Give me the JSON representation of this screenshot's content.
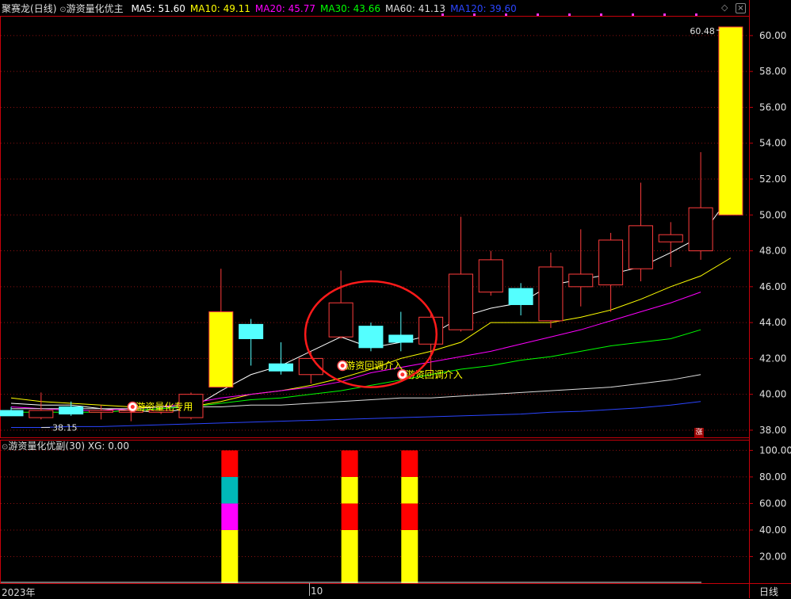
{
  "header": {
    "stock": "聚赛龙",
    "period": "(日线)",
    "indicator": "游资量化优主",
    "ma": [
      {
        "label": "MA5: 51.60",
        "color": "#ffffff"
      },
      {
        "label": "MA10: 49.11",
        "color": "#ffff00"
      },
      {
        "label": "MA20: 45.77",
        "color": "#ff00ff"
      },
      {
        "label": "MA30: 43.66",
        "color": "#00ff00"
      },
      {
        "label": "MA60: 41.13",
        "color": "#dddddd"
      },
      {
        "label": "MA120: 39.60",
        "color": "#2b45ff"
      }
    ]
  },
  "sub_header": {
    "indicator": "游资量化优副(30)",
    "xg": "XG: 0.00"
  },
  "footer": {
    "year_label": "2023年",
    "month_label": "10",
    "period_button": "日线"
  },
  "side_marker": "涨",
  "colors": {
    "up": "#ff3c3c",
    "down": "#54ffff",
    "limit_up": "#ffff00",
    "axis": "#c8000a",
    "grid": "#8a1010"
  },
  "chart_data": [
    {
      "type": "candlestick",
      "title": "",
      "ylim": [
        37.6,
        61.1
      ],
      "y_ticks": [
        "38.00",
        "40.00",
        "42.00",
        "44.00",
        "46.00",
        "48.00",
        "50.00",
        "52.00",
        "54.00",
        "56.00",
        "58.00",
        "60.00"
      ],
      "max_label": "60.48",
      "min_label": "38.15",
      "candles": [
        {
          "o": 39.1,
          "h": 39.3,
          "l": 38.8,
          "c": 38.8,
          "t": "down"
        },
        {
          "o": 38.7,
          "h": 40.1,
          "l": 38.6,
          "c": 39.1,
          "t": "up"
        },
        {
          "o": 39.3,
          "h": 39.6,
          "l": 38.8,
          "c": 38.9,
          "t": "down"
        },
        {
          "o": 39.0,
          "h": 39.4,
          "l": 38.6,
          "c": 39.1,
          "t": "up"
        },
        {
          "o": 39.0,
          "h": 39.5,
          "l": 38.5,
          "c": 39.1,
          "t": "up"
        },
        {
          "o": 39.1,
          "h": 39.2,
          "l": 38.9,
          "c": 39.0,
          "t": "up"
        },
        {
          "o": 38.7,
          "h": 40.1,
          "l": 38.6,
          "c": 40.0,
          "t": "up"
        },
        {
          "o": 40.4,
          "h": 47.0,
          "l": 40.4,
          "c": 44.6,
          "t": "limit"
        },
        {
          "o": 43.9,
          "h": 44.2,
          "l": 41.6,
          "c": 43.1,
          "t": "down"
        },
        {
          "o": 41.7,
          "h": 42.9,
          "l": 41.1,
          "c": 41.3,
          "t": "down"
        },
        {
          "o": 41.1,
          "h": 42.4,
          "l": 40.6,
          "c": 42.0,
          "t": "up"
        },
        {
          "o": 43.2,
          "h": 46.9,
          "l": 43.1,
          "c": 45.1,
          "t": "up"
        },
        {
          "o": 43.8,
          "h": 44.0,
          "l": 42.4,
          "c": 42.6,
          "t": "down"
        },
        {
          "o": 43.3,
          "h": 44.6,
          "l": 42.4,
          "c": 42.9,
          "t": "down"
        },
        {
          "o": 42.8,
          "h": 44.5,
          "l": 41.2,
          "c": 44.3,
          "t": "up"
        },
        {
          "o": 43.6,
          "h": 49.9,
          "l": 43.5,
          "c": 46.7,
          "t": "up"
        },
        {
          "o": 45.7,
          "h": 48.0,
          "l": 45.5,
          "c": 47.5,
          "t": "up"
        },
        {
          "o": 45.9,
          "h": 46.2,
          "l": 44.4,
          "c": 45.0,
          "t": "down"
        },
        {
          "o": 44.1,
          "h": 47.9,
          "l": 43.7,
          "c": 47.1,
          "t": "up"
        },
        {
          "o": 46.0,
          "h": 49.2,
          "l": 44.9,
          "c": 46.7,
          "t": "up"
        },
        {
          "o": 46.1,
          "h": 49.0,
          "l": 44.6,
          "c": 48.6,
          "t": "up"
        },
        {
          "o": 47.0,
          "h": 51.8,
          "l": 46.3,
          "c": 49.4,
          "t": "up"
        },
        {
          "o": 48.5,
          "h": 49.6,
          "l": 47.1,
          "c": 48.9,
          "t": "up"
        },
        {
          "o": 48.0,
          "h": 53.5,
          "l": 47.5,
          "c": 50.4,
          "t": "up"
        },
        {
          "o": 50.0,
          "h": 60.5,
          "l": 50.0,
          "c": 60.48,
          "t": "limit"
        }
      ],
      "series": [
        {
          "name": "MA5",
          "color": "#ffffff",
          "values": [
            39.5,
            39.4,
            39.4,
            39.2,
            39.1,
            39.0,
            39.2,
            40.2,
            41.1,
            41.6,
            42.4,
            43.2,
            42.6,
            42.9,
            43.3,
            44.3,
            44.8,
            45.1,
            46.1,
            46.4,
            46.7,
            47.1,
            47.9,
            48.8,
            51.1
          ]
        },
        {
          "name": "MA10",
          "color": "#ffff00",
          "values": [
            39.8,
            39.6,
            39.5,
            39.4,
            39.3,
            39.3,
            39.3,
            39.6,
            40.0,
            40.2,
            40.5,
            40.9,
            41.4,
            42.0,
            42.4,
            42.9,
            44.0,
            44.0,
            44.0,
            44.3,
            44.7,
            45.3,
            46.0,
            46.6,
            47.6
          ]
        },
        {
          "name": "MA20",
          "color": "#ff00ff",
          "values": [
            39.3,
            39.2,
            39.1,
            39.1,
            39.2,
            39.3,
            39.5,
            39.8,
            40.0,
            40.2,
            40.4,
            40.7,
            41.2,
            41.5,
            41.8,
            42.1,
            42.4,
            42.8,
            43.2,
            43.6,
            44.1,
            44.6,
            45.1,
            45.7
          ]
        },
        {
          "name": "MA30",
          "color": "#00ff00",
          "values": [
            39.0,
            39.0,
            39.0,
            39.0,
            39.1,
            39.2,
            39.3,
            39.5,
            39.7,
            39.8,
            40.0,
            40.2,
            40.5,
            40.8,
            41.1,
            41.4,
            41.6,
            41.9,
            42.1,
            42.4,
            42.7,
            42.9,
            43.1,
            43.6
          ]
        },
        {
          "name": "MA60",
          "color": "#dddddd",
          "values": [
            39.2,
            39.2,
            39.2,
            39.2,
            39.2,
            39.3,
            39.3,
            39.3,
            39.4,
            39.4,
            39.5,
            39.6,
            39.7,
            39.8,
            39.8,
            39.9,
            40.0,
            40.1,
            40.2,
            40.3,
            40.4,
            40.6,
            40.8,
            41.1
          ]
        },
        {
          "name": "MA120",
          "color": "#2b45ff",
          "values": [
            38.15,
            38.15,
            38.2,
            38.2,
            38.25,
            38.3,
            38.35,
            38.4,
            38.45,
            38.5,
            38.55,
            38.6,
            38.65,
            38.7,
            38.75,
            38.8,
            38.85,
            38.9,
            39.0,
            39.05,
            39.15,
            39.25,
            39.4,
            39.6
          ]
        }
      ],
      "annotations": [
        {
          "text": "游资量化专用",
          "candle": 4,
          "price": 39.3
        },
        {
          "text": "游资回调介入",
          "candle": 11,
          "price": 41.6
        },
        {
          "text": "游资回调介入",
          "candle": 13,
          "price": 41.1
        }
      ],
      "highlight_circle": {
        "candles": [
          11,
          13
        ],
        "price_range": [
          40.4,
          46.3
        ]
      }
    },
    {
      "type": "stacked_bar",
      "title": "",
      "ylim": [
        0,
        108
      ],
      "y_ticks": [
        "20.00",
        "40.00",
        "60.00",
        "80.00",
        "100.00"
      ],
      "bars": [
        {
          "candle": 7,
          "segments": [
            {
              "from": 0,
              "to": 40,
              "color": "#ffff00"
            },
            {
              "from": 40,
              "to": 60,
              "color": "#ff00ff"
            },
            {
              "from": 60,
              "to": 80,
              "color": "#00b8b8"
            },
            {
              "from": 80,
              "to": 100,
              "color": "#ff0000"
            }
          ]
        },
        {
          "candle": 11,
          "segments": [
            {
              "from": 0,
              "to": 40,
              "color": "#ffff00"
            },
            {
              "from": 40,
              "to": 60,
              "color": "#ff0000"
            },
            {
              "from": 60,
              "to": 80,
              "color": "#ffff00"
            },
            {
              "from": 80,
              "to": 100,
              "color": "#ff0000"
            }
          ]
        },
        {
          "candle": 13,
          "segments": [
            {
              "from": 0,
              "to": 40,
              "color": "#ffff00"
            },
            {
              "from": 40,
              "to": 60,
              "color": "#ff0000"
            },
            {
              "from": 60,
              "to": 80,
              "color": "#ffff00"
            },
            {
              "from": 80,
              "to": 100,
              "color": "#ff0000"
            }
          ]
        }
      ]
    }
  ]
}
